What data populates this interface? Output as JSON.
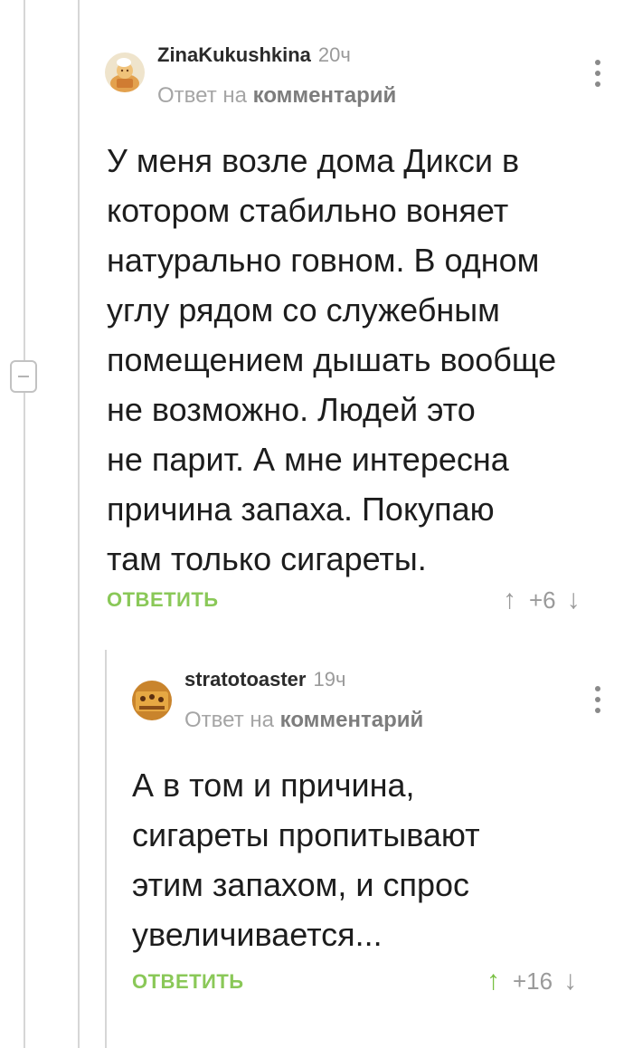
{
  "comment_1": {
    "username": "ZinaKukushkina",
    "time": "20ч",
    "reply_prefix": "Ответ на",
    "reply_link": "комментарий",
    "body_lines": [
      "У меня возле дома Дикси в",
      "котором стабильно воняет",
      "натурально говном. В одном",
      "углу рядом со служебным",
      "помещением дышать вообще",
      "не возможно. Людей это",
      "не парит. А мне интересна",
      "причина запаха. Покупаю",
      "там только сигареты."
    ],
    "reply_button": "ОТВЕТИТЬ",
    "rating": "+6",
    "upvote_icon": "arrow-up-icon",
    "downvote_icon": "arrow-down-icon"
  },
  "comment_2": {
    "username": "stratotoaster",
    "time": "19ч",
    "reply_prefix": "Ответ на",
    "reply_link": "комментарий",
    "body_lines": [
      "А в том и причина,",
      "сигареты пропитывают",
      "этим запахом, и спрос",
      "увеличивается..."
    ],
    "reply_button": "ОТВЕТИТЬ",
    "rating": "+16",
    "upvote_icon": "arrow-up-icon",
    "downvote_icon": "arrow-down-icon"
  },
  "colors": {
    "accent_green": "#8ac858",
    "upvote_active": "#79c043",
    "thread_line": "#d6d6d6",
    "muted_text": "#9a9a9a"
  }
}
